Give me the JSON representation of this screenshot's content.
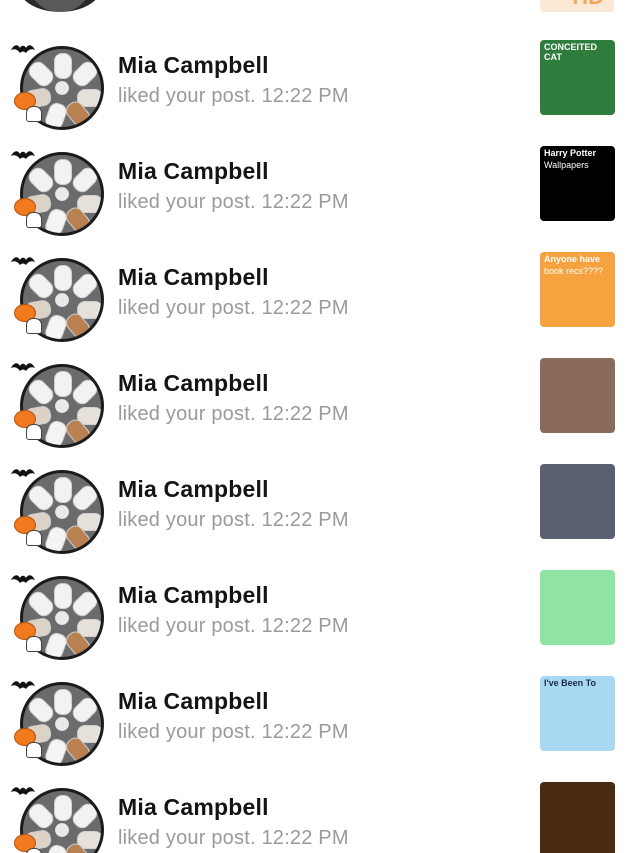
{
  "partial_row": {
    "thumb_text": "HD"
  },
  "notifications": [
    {
      "name": "Mia Campbell",
      "action": "liked your post. 12:22 PM",
      "thumb": {
        "bg": "#2f7d3c",
        "title": "CONCEITED CAT",
        "title_color": "#ffffff",
        "body": "",
        "body_color": "#ffffff"
      }
    },
    {
      "name": "Mia Campbell",
      "action": "liked your post. 12:22 PM",
      "thumb": {
        "bg": "#000000",
        "title": "Harry Potter",
        "title_color": "#ffffff",
        "body": "Wallpapers",
        "body_color": "#ffffff"
      }
    },
    {
      "name": "Mia Campbell",
      "action": "liked your post. 12:22 PM",
      "thumb": {
        "bg": "#f6a23e",
        "title": "Anyone have",
        "title_color": "#ffffff",
        "body": "book recs????",
        "body_color": "#ffffff"
      }
    },
    {
      "name": "Mia Campbell",
      "action": "liked your post. 12:22 PM",
      "thumb": {
        "bg": "#8a6a5a",
        "title": "",
        "title_color": "#ffffff",
        "body": "",
        "body_color": "#ffffff"
      }
    },
    {
      "name": "Mia Campbell",
      "action": "liked your post. 12:22 PM",
      "thumb": {
        "bg": "#5a6070",
        "title": "",
        "title_color": "#ffffff",
        "body": "",
        "body_color": "#ffffff"
      }
    },
    {
      "name": "Mia Campbell",
      "action": "liked your post. 12:22 PM",
      "thumb": {
        "bg": "#8fe3a3",
        "title": "",
        "title_color": "#ffffff",
        "body": "",
        "body_color": "#ffffff"
      }
    },
    {
      "name": "Mia Campbell",
      "action": "liked your post. 12:22 PM",
      "thumb": {
        "bg": "#a9d9f2",
        "title": "I've Been To",
        "title_color": "#1c2a4a",
        "body": "",
        "body_color": "#1c2a4a"
      }
    },
    {
      "name": "Mia Campbell",
      "action": "liked your post. 12:22 PM",
      "thumb": {
        "bg": "#4a2a12",
        "title": "",
        "title_color": "#ffffff",
        "body": "",
        "body_color": "#ffffff"
      }
    }
  ]
}
